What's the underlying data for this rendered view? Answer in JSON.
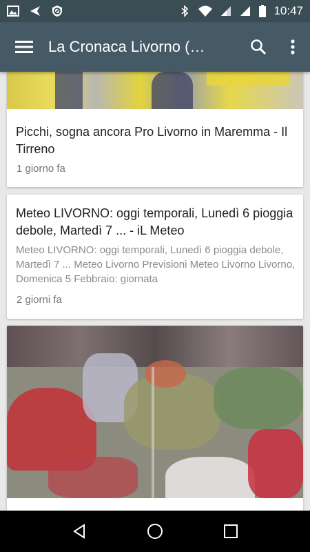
{
  "status_bar": {
    "time": "10:47",
    "icons": [
      "image-icon",
      "send-icon",
      "blocked-icon",
      "bluetooth-icon",
      "wifi-icon",
      "signal-icon",
      "signal-icon",
      "battery-icon"
    ]
  },
  "app_bar": {
    "title": "La Cronaca Livorno (…",
    "icons": [
      "menu-icon",
      "search-icon",
      "more-vert-icon"
    ]
  },
  "articles": [
    {
      "title": "Picchi, sogna ancora Pro Livorno in Maremma - Il Tirreno",
      "time": "1 giorno fa"
    },
    {
      "title": "Meteo LIVORNO: oggi temporali, Lunedì 6 pioggia debole, Martedì 7 ... - iL Meteo",
      "description": "Meteo LIVORNO: oggi temporali, Lunedì 6 pioggia debole, Martedì 7 ... Meteo Livorno Previsioni Meteo Livorno Livorno, Domenica 5 Febbraio: giornata",
      "time": "2 giorni fa"
    }
  ],
  "colors": {
    "status_bar": "#3a4d55",
    "app_bar": "#455a64",
    "background": "#e8e8e8"
  },
  "nav_bar": {
    "icons": [
      "back-icon",
      "home-icon",
      "recents-icon"
    ]
  }
}
